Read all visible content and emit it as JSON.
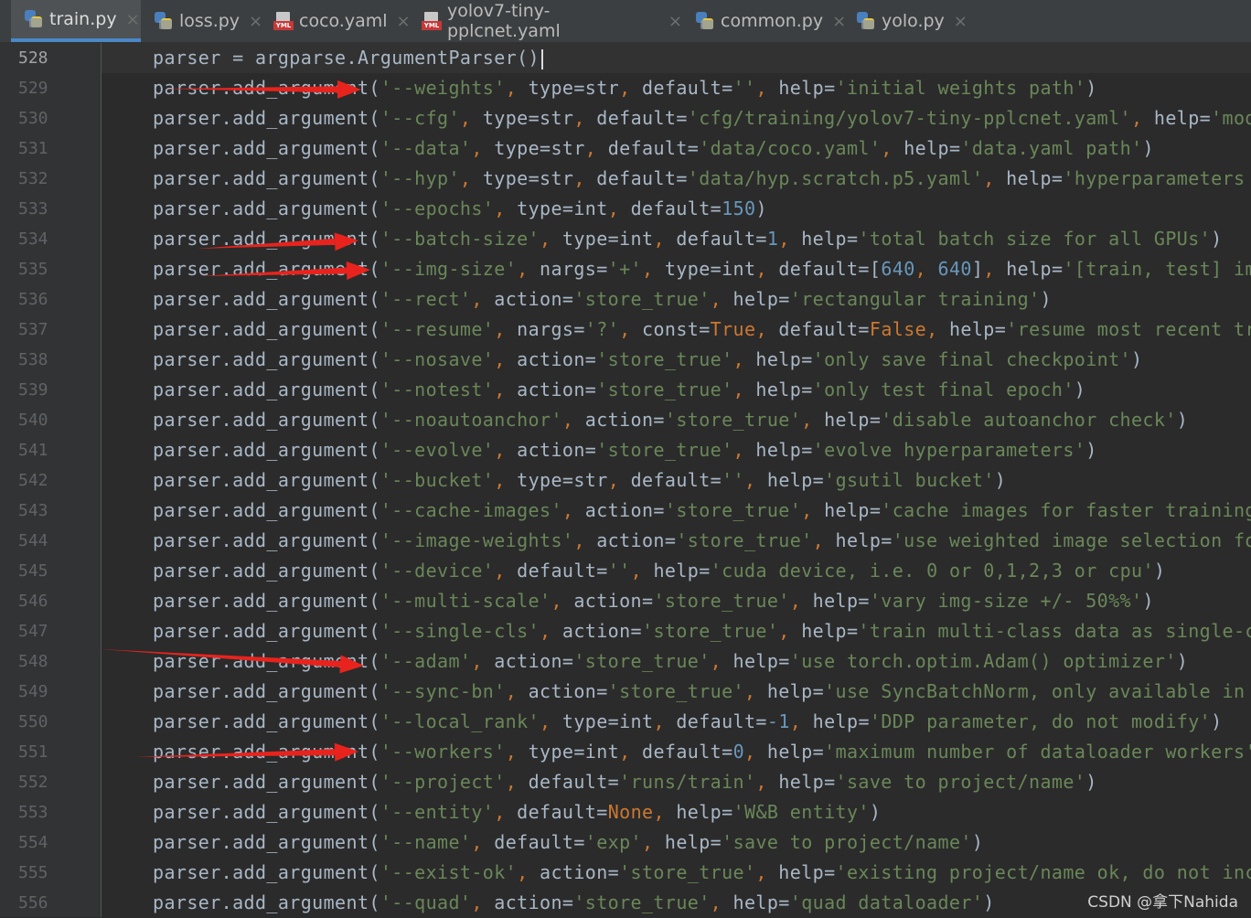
{
  "tabs": [
    {
      "name": "train.py",
      "icon": "python-file-icon",
      "active": true
    },
    {
      "name": "loss.py",
      "icon": "python-file-icon",
      "active": false
    },
    {
      "name": "coco.yaml",
      "icon": "yaml-file-icon",
      "active": false
    },
    {
      "name": "yolov7-tiny-pplcnet.yaml",
      "icon": "yaml-file-icon",
      "active": false
    },
    {
      "name": "common.py",
      "icon": "python-file-icon",
      "active": false
    },
    {
      "name": "yolo.py",
      "icon": "python-file-icon",
      "active": false
    }
  ],
  "tab_close_glyph": "×",
  "yml_badge": "YML",
  "left_edge_mark": "a",
  "current_line": "528",
  "lines": [
    {
      "num": "528",
      "code": "parser = argparse.ArgumentParser()"
    },
    {
      "num": "529",
      "code": "parser.add_argument('--weights', type=str, default='', help='initial weights path')"
    },
    {
      "num": "530",
      "code": "parser.add_argument('--cfg', type=str, default='cfg/training/yolov7-tiny-pplcnet.yaml', help='model."
    },
    {
      "num": "531",
      "code": "parser.add_argument('--data', type=str, default='data/coco.yaml', help='data.yaml path')"
    },
    {
      "num": "532",
      "code": "parser.add_argument('--hyp', type=str, default='data/hyp.scratch.p5.yaml', help='hyperparameters pat"
    },
    {
      "num": "533",
      "code": "parser.add_argument('--epochs', type=int, default=150)"
    },
    {
      "num": "534",
      "code": "parser.add_argument('--batch-size', type=int, default=1, help='total batch size for all GPUs')"
    },
    {
      "num": "535",
      "code": "parser.add_argument('--img-size', nargs='+', type=int, default=[640, 640], help='[train, test] image"
    },
    {
      "num": "536",
      "code": "parser.add_argument('--rect', action='store_true', help='rectangular training')"
    },
    {
      "num": "537",
      "code": "parser.add_argument('--resume', nargs='?', const=True, default=False, help='resume most recent train"
    },
    {
      "num": "538",
      "code": "parser.add_argument('--nosave', action='store_true', help='only save final checkpoint')"
    },
    {
      "num": "539",
      "code": "parser.add_argument('--notest', action='store_true', help='only test final epoch')"
    },
    {
      "num": "540",
      "code": "parser.add_argument('--noautoanchor', action='store_true', help='disable autoanchor check')"
    },
    {
      "num": "541",
      "code": "parser.add_argument('--evolve', action='store_true', help='evolve hyperparameters')"
    },
    {
      "num": "542",
      "code": "parser.add_argument('--bucket', type=str, default='', help='gsutil bucket')"
    },
    {
      "num": "543",
      "code": "parser.add_argument('--cache-images', action='store_true', help='cache images for faster training')"
    },
    {
      "num": "544",
      "code": "parser.add_argument('--image-weights', action='store_true', help='use weighted image selection for t"
    },
    {
      "num": "545",
      "code": "parser.add_argument('--device', default='', help='cuda device, i.e. 0 or 0,1,2,3 or cpu')"
    },
    {
      "num": "546",
      "code": "parser.add_argument('--multi-scale', action='store_true', help='vary img-size +/- 50%%')"
    },
    {
      "num": "547",
      "code": "parser.add_argument('--single-cls', action='store_true', help='train multi-class data as single-clas"
    },
    {
      "num": "548",
      "code": "parser.add_argument('--adam', action='store_true', help='use torch.optim.Adam() optimizer')"
    },
    {
      "num": "549",
      "code": "parser.add_argument('--sync-bn', action='store_true', help='use SyncBatchNorm, only available in DDP"
    },
    {
      "num": "550",
      "code": "parser.add_argument('--local_rank', type=int, default=-1, help='DDP parameter, do not modify')"
    },
    {
      "num": "551",
      "code": "parser.add_argument('--workers', type=int, default=0, help='maximum number of dataloader workers')"
    },
    {
      "num": "552",
      "code": "parser.add_argument('--project', default='runs/train', help='save to project/name')"
    },
    {
      "num": "553",
      "code": "parser.add_argument('--entity', default=None, help='W&B entity')"
    },
    {
      "num": "554",
      "code": "parser.add_argument('--name', default='exp', help='save to project/name')"
    },
    {
      "num": "555",
      "code": "parser.add_argument('--exist-ok', action='store_true', help='existing project/name ok, do not increm"
    },
    {
      "num": "556",
      "code": "parser.add_argument('--quad', action='store_true', help='quad dataloader')"
    }
  ],
  "annotation_arrow_lines": [
    "529",
    "534",
    "535",
    "548",
    "551"
  ],
  "annotation_color": "#e8231d",
  "watermark": "CSDN @拿下Nahida",
  "colors": {
    "editor_bg": "#2b2b2b",
    "gutter_bg": "#313335",
    "tabbar_bg": "#3c3f41",
    "active_tab_underline": "#4a88c7",
    "keyword": "#cc7832",
    "string": "#6a8759",
    "number": "#6897bb",
    "text": "#a9b7c6",
    "line_number": "#606366"
  }
}
